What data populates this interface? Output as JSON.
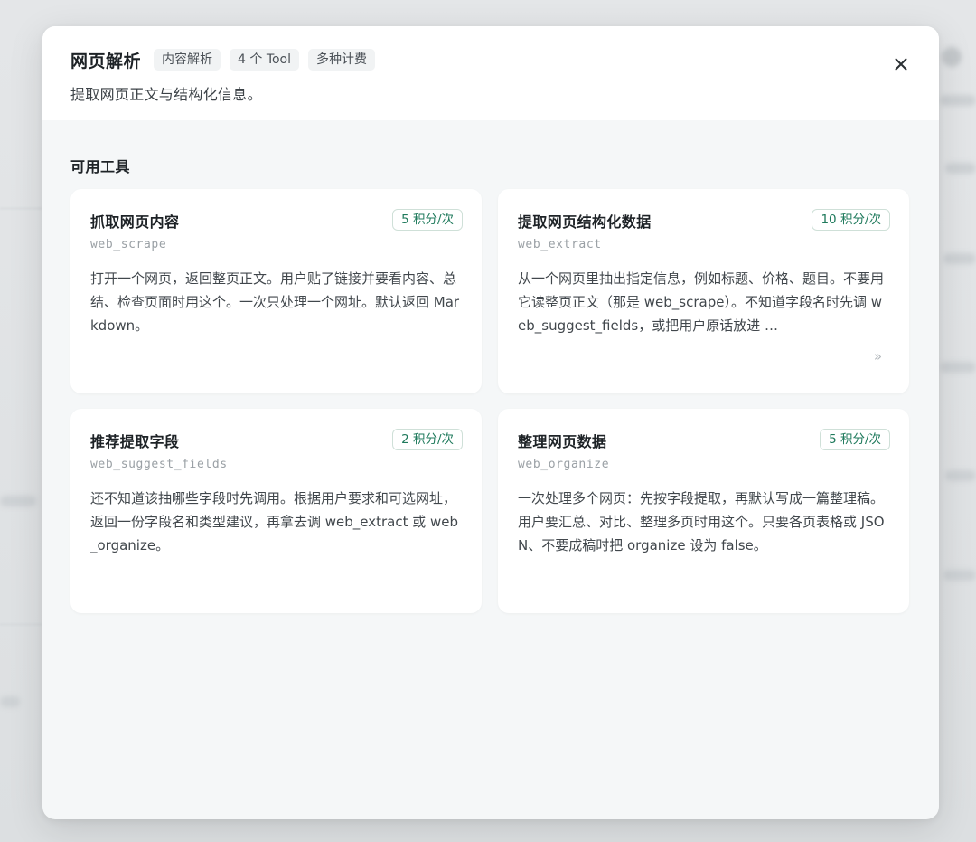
{
  "modal": {
    "title": "网页解析",
    "tags": [
      "内容解析",
      "4 个 Tool",
      "多种计费"
    ],
    "subtitle": "提取网页正文与结构化信息。",
    "close_icon": "close-icon"
  },
  "section": {
    "title": "可用工具"
  },
  "tools": [
    {
      "name": "抓取网页内容",
      "id": "web_scrape",
      "price": "5 积分/次",
      "description": "打开一个网页，返回整页正文。用户贴了链接并要看内容、总结、检查页面时用这个。一次只处理一个网址。默认返回 Markdown。"
    },
    {
      "name": "提取网页结构化数据",
      "id": "web_extract",
      "price": "10 积分/次",
      "description": "从一个网页里抽出指定信息，例如标题、价格、题目。不要用它读整页正文（那是 web_scrape）。不知道字段名时先调 web_suggest_fields，或把用户原话放进 …",
      "expand_icon": "»"
    },
    {
      "name": "推荐提取字段",
      "id": "web_suggest_fields",
      "price": "2 积分/次",
      "description": "还不知道该抽哪些字段时先调用。根据用户要求和可选网址，返回一份字段名和类型建议，再拿去调 web_extract 或 web_organize。"
    },
    {
      "name": "整理网页数据",
      "id": "web_organize",
      "price": "5 积分/次",
      "description": "一次处理多个网页：先按字段提取，再默认写成一篇整理稿。用户要汇总、对比、整理多页时用这个。只要各页表格或 JSON、不要成稿时把 organize 设为 false。"
    }
  ],
  "colors": {
    "accent_green": "#1f7a5c",
    "card_bg": "#ffffff",
    "modal_bg": "#f5f7f8"
  }
}
